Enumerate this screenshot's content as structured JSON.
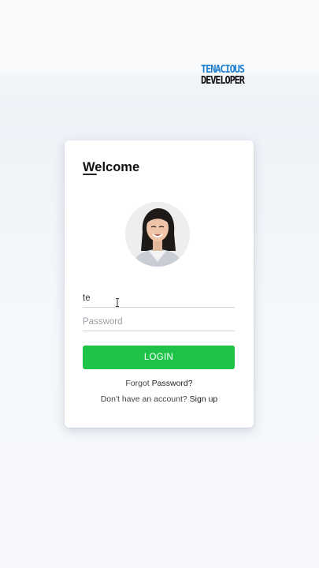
{
  "brand": {
    "line1": "TENACIOUS",
    "line2": "DEVELOPER"
  },
  "card": {
    "title": "Welcome",
    "username_value": "te",
    "password_placeholder": "Password",
    "login_label": "LOGIN",
    "forgot_prefix": "Forgot",
    "forgot_link": "Password?",
    "signup_prefix": "Don't have an account?",
    "signup_link": "Sign up"
  },
  "colors": {
    "accent": "#1fc34a",
    "brand_blue": "#1e7fd1"
  }
}
